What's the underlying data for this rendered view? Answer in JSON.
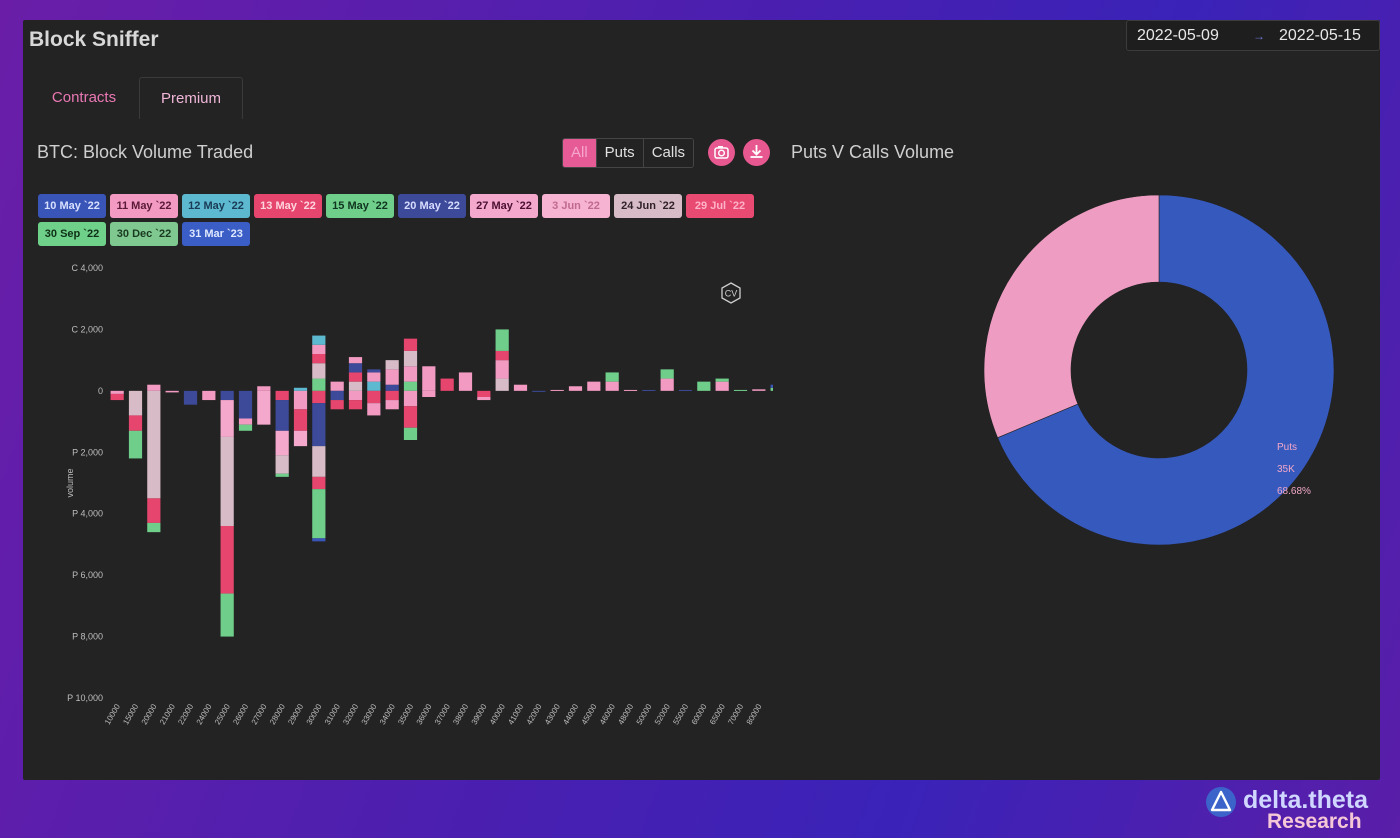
{
  "app": {
    "title": "Block Sniffer"
  },
  "date_range": {
    "from": "2022-05-09",
    "arrow": "→",
    "to": "2022-05-15"
  },
  "tabs": [
    {
      "label": "Contracts"
    },
    {
      "label": "Premium"
    }
  ],
  "left_panel": {
    "title": "BTC: Block Volume Traded",
    "filters": [
      {
        "label": "All",
        "active": true
      },
      {
        "label": "Puts",
        "active": false
      },
      {
        "label": "Calls",
        "active": false
      }
    ],
    "icon_buttons": [
      {
        "icon": "camera-icon"
      },
      {
        "icon": "download-icon"
      }
    ],
    "badge": {
      "icon": "cv-hexagon-icon",
      "label": "CV"
    },
    "expiry_chips": [
      {
        "label": "10 May `22",
        "color": "#3a55b8",
        "text": "#d8e0ff"
      },
      {
        "label": "11 May `22",
        "color": "#f29ac2",
        "text": "#5a1a35"
      },
      {
        "label": "12 May `22",
        "color": "#5db9cf",
        "text": "#1a3a55"
      },
      {
        "label": "13 May `22",
        "color": "#e6466e",
        "text": "#ffd5df"
      },
      {
        "label": "15 May `22",
        "color": "#6fcf8a",
        "text": "#103520"
      },
      {
        "label": "20 May `22",
        "color": "#3d4a9a",
        "text": "#d8dcff"
      },
      {
        "label": "27 May `22",
        "color": "#f4a8cc",
        "text": "#4a1030"
      },
      {
        "label": "3 Jun `22",
        "color": "#f7b3d2",
        "text": "#c06a90"
      },
      {
        "label": "24 Jun `22",
        "color": "#d7bcc8",
        "text": "#302028"
      },
      {
        "label": "29 Jul `22",
        "color": "#e84a72",
        "text": "#ffb3c8"
      },
      {
        "label": "30 Sep `22",
        "color": "#6fd08a",
        "text": "#0f3018"
      },
      {
        "label": "30 Dec `22",
        "color": "#7fc990",
        "text": "#1a3a22"
      },
      {
        "label": "31 Mar `23",
        "color": "#3a5ec6",
        "text": "#e0e8ff"
      }
    ]
  },
  "right_panel": {
    "title": "Puts V Calls Volume"
  },
  "brand": {
    "name": "delta.theta",
    "sub": "Research"
  },
  "chart_data": [
    {
      "type": "bar",
      "stacked": true,
      "ylabel": "volume",
      "ylim": [
        -10000,
        4000
      ],
      "yticks": [
        {
          "value": 4000,
          "label": "C 4,000"
        },
        {
          "value": 2000,
          "label": "C 2,000"
        },
        {
          "value": 0,
          "label": "0"
        },
        {
          "value": -2000,
          "label": "P 2,000"
        },
        {
          "value": -4000,
          "label": "P 4,000"
        },
        {
          "value": -6000,
          "label": "P 6,000"
        },
        {
          "value": -8000,
          "label": "P 8,000"
        },
        {
          "value": -10000,
          "label": "P 10,000"
        }
      ],
      "categories": [
        "10000",
        "15000",
        "20000",
        "21000",
        "22000",
        "24000",
        "25000",
        "26000",
        "27000",
        "28000",
        "29000",
        "30000",
        "31000",
        "32000",
        "33000",
        "34000",
        "35000",
        "36000",
        "37000",
        "38000",
        "39000",
        "40000",
        "41000",
        "42000",
        "43000",
        "44000",
        "45000",
        "46000",
        "48000",
        "50000",
        "52000",
        "55000",
        "60000",
        "65000",
        "70000",
        "80000"
      ],
      "stacks": [
        [
          {
            "v": -100,
            "c": "#f29ac2"
          },
          {
            "v": -200,
            "c": "#e6466e"
          }
        ],
        [
          {
            "v": -800,
            "c": "#d7bcc8"
          },
          {
            "v": -500,
            "c": "#e6466e"
          },
          {
            "v": -900,
            "c": "#6fcf8a"
          }
        ],
        [
          {
            "v": 200,
            "c": "#f29ac2"
          },
          {
            "v": -3500,
            "c": "#d7bcc8"
          },
          {
            "v": -800,
            "c": "#e6466e"
          },
          {
            "v": -300,
            "c": "#6fcf8a"
          }
        ],
        [
          {
            "v": -50,
            "c": "#f29ac2"
          }
        ],
        [
          {
            "v": -450,
            "c": "#3d4a9a"
          }
        ],
        [
          {
            "v": -300,
            "c": "#f29ac2"
          }
        ],
        [
          {
            "v": -300,
            "c": "#3d4a9a"
          },
          {
            "v": -1200,
            "c": "#f4a8cc"
          },
          {
            "v": -2900,
            "c": "#d7bcc8"
          },
          {
            "v": -2200,
            "c": "#e6466e"
          },
          {
            "v": -1400,
            "c": "#6fcf8a"
          }
        ],
        [
          {
            "v": -900,
            "c": "#3d4a9a"
          },
          {
            "v": -200,
            "c": "#f29ac2"
          },
          {
            "v": -200,
            "c": "#6fcf8a"
          }
        ],
        [
          {
            "v": 150,
            "c": "#f29ac2"
          },
          {
            "v": -1100,
            "c": "#f4a8cc"
          }
        ],
        [
          {
            "v": -300,
            "c": "#e6466e"
          },
          {
            "v": -1000,
            "c": "#3d4a9a"
          },
          {
            "v": -800,
            "c": "#f4a8cc"
          },
          {
            "v": -600,
            "c": "#d7bcc8"
          },
          {
            "v": -100,
            "c": "#6fcf8a"
          }
        ],
        [
          {
            "v": 100,
            "c": "#5db9cf"
          },
          {
            "v": -600,
            "c": "#f29ac2"
          },
          {
            "v": -700,
            "c": "#e6466e"
          },
          {
            "v": -500,
            "c": "#f4a8cc"
          }
        ],
        [
          {
            "v": 400,
            "c": "#6fcf8a"
          },
          {
            "v": 500,
            "c": "#d7bcc8"
          },
          {
            "v": 300,
            "c": "#e6466e"
          },
          {
            "v": 300,
            "c": "#f29ac2"
          },
          {
            "v": 300,
            "c": "#5db9cf"
          },
          {
            "v": -400,
            "c": "#e6466e"
          },
          {
            "v": -1400,
            "c": "#3d4a9a"
          },
          {
            "v": -1000,
            "c": "#d7bcc8"
          },
          {
            "v": -400,
            "c": "#e6466e"
          },
          {
            "v": -1600,
            "c": "#6fcf8a"
          },
          {
            "v": -100,
            "c": "#3a55b8"
          }
        ],
        [
          {
            "v": 300,
            "c": "#f29ac2"
          },
          {
            "v": -300,
            "c": "#3d4a9a"
          },
          {
            "v": -300,
            "c": "#e6466e"
          }
        ],
        [
          {
            "v": 300,
            "c": "#d7bcc8"
          },
          {
            "v": 300,
            "c": "#e6466e"
          },
          {
            "v": 300,
            "c": "#3d4a9a"
          },
          {
            "v": 200,
            "c": "#f29ac2"
          },
          {
            "v": -300,
            "c": "#f29ac2"
          },
          {
            "v": -300,
            "c": "#e6466e"
          }
        ],
        [
          {
            "v": 300,
            "c": "#5db9cf"
          },
          {
            "v": 300,
            "c": "#f29ac2"
          },
          {
            "v": 100,
            "c": "#3d4a9a"
          },
          {
            "v": -400,
            "c": "#e6466e"
          },
          {
            "v": -400,
            "c": "#f29ac2"
          }
        ],
        [
          {
            "v": 200,
            "c": "#3d4a9a"
          },
          {
            "v": 500,
            "c": "#f29ac2"
          },
          {
            "v": 300,
            "c": "#d7bcc8"
          },
          {
            "v": -300,
            "c": "#e6466e"
          },
          {
            "v": -300,
            "c": "#f29ac2"
          }
        ],
        [
          {
            "v": 300,
            "c": "#6fcf8a"
          },
          {
            "v": 500,
            "c": "#f29ac2"
          },
          {
            "v": 500,
            "c": "#d7bcc8"
          },
          {
            "v": 400,
            "c": "#e6466e"
          },
          {
            "v": -500,
            "c": "#f29ac2"
          },
          {
            "v": -700,
            "c": "#e6466e"
          },
          {
            "v": -400,
            "c": "#6fcf8a"
          }
        ],
        [
          {
            "v": 800,
            "c": "#f29ac2"
          },
          {
            "v": -200,
            "c": "#f29ac2"
          }
        ],
        [
          {
            "v": 400,
            "c": "#e6466e"
          }
        ],
        [
          {
            "v": 600,
            "c": "#f29ac2"
          }
        ],
        [
          {
            "v": -200,
            "c": "#e6466e"
          },
          {
            "v": -100,
            "c": "#f29ac2"
          }
        ],
        [
          {
            "v": 400,
            "c": "#d7bcc8"
          },
          {
            "v": 600,
            "c": "#f29ac2"
          },
          {
            "v": 300,
            "c": "#e6466e"
          },
          {
            "v": 700,
            "c": "#6fcf8a"
          }
        ],
        [
          {
            "v": 200,
            "c": "#f29ac2"
          }
        ],
        [
          {
            "v": -30,
            "c": "#3d4a9a"
          }
        ],
        [
          {
            "v": 30,
            "c": "#f29ac2"
          }
        ],
        [
          {
            "v": 150,
            "c": "#f29ac2"
          }
        ],
        [
          {
            "v": 300,
            "c": "#f29ac2"
          }
        ],
        [
          {
            "v": 300,
            "c": "#f29ac2"
          },
          {
            "v": 300,
            "c": "#6fcf8a"
          }
        ],
        [
          {
            "v": 30,
            "c": "#f29ac2"
          }
        ],
        [
          {
            "v": 30,
            "c": "#3d4a9a"
          }
        ],
        [
          {
            "v": 400,
            "c": "#f29ac2"
          },
          {
            "v": 300,
            "c": "#6fcf8a"
          }
        ],
        [
          {
            "v": 30,
            "c": "#3d4a9a"
          }
        ],
        [
          {
            "v": 300,
            "c": "#6fcf8a"
          }
        ],
        [
          {
            "v": 300,
            "c": "#f29ac2"
          },
          {
            "v": 100,
            "c": "#6fcf8a"
          }
        ],
        [
          {
            "v": 30,
            "c": "#6fcf8a"
          }
        ],
        [
          {
            "v": 50,
            "c": "#f29ac2"
          }
        ],
        [
          {
            "v": 100,
            "c": "#6fcf8a"
          },
          {
            "v": 100,
            "c": "#3a55b8"
          }
        ]
      ]
    },
    {
      "type": "pie",
      "donut": true,
      "slices": [
        {
          "name": "Puts",
          "value_label": "35K",
          "percent": 68.68,
          "percent_label": "68.68%",
          "color": "#3659be"
        },
        {
          "name": "",
          "value_label": "",
          "percent": 31.32,
          "percent_label": "",
          "color": "#ee9cc2"
        }
      ]
    }
  ]
}
